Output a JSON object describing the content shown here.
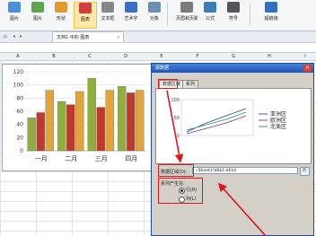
{
  "ribbon": {
    "items": [
      {
        "label": "图片",
        "icon": "picture-icon",
        "color": "#4a90d9"
      },
      {
        "label": "图片",
        "icon": "image-icon",
        "color": "#5fa44f"
      },
      {
        "label": "形状",
        "icon": "shapes-icon",
        "color": "#e09a2d"
      },
      {
        "label": "图表",
        "icon": "chart-icon",
        "color": "#d23d3d"
      },
      {
        "label": "文本框",
        "icon": "textbox-icon",
        "color": "#888888"
      },
      {
        "label": "艺术字",
        "icon": "wordart-icon",
        "color": "#3a6fc4"
      },
      {
        "label": "对象",
        "icon": "object-icon",
        "color": "#6b8fb5"
      },
      {
        "label": "页眉和页脚",
        "icon": "header-footer-icon",
        "color": "#7a7a7a"
      },
      {
        "label": "公式",
        "icon": "formula-icon",
        "color": "#3d7ab8"
      },
      {
        "label": "符号",
        "icon": "symbol-icon",
        "color": "#555555"
      },
      {
        "label": "超链接",
        "icon": "hyperlink-icon",
        "color": "#2f6fbf"
      }
    ]
  },
  "tabbar": {
    "doc_title": "文档1 中的 图表"
  },
  "sheet": {
    "columns": [
      "A",
      "B",
      "C",
      "D",
      "E",
      "F",
      "G",
      "H",
      "I"
    ]
  },
  "chart_data": {
    "type": "bar",
    "categories": [
      "一月",
      "二月",
      "三月",
      "四月"
    ],
    "yticks": [
      "0",
      "20",
      "40",
      "60",
      "80",
      "100",
      "120"
    ],
    "ylim": [
      0,
      120
    ],
    "series": [
      {
        "color": "#8fae3c",
        "values": [
          50,
          75,
          110,
          98
        ]
      },
      {
        "color": "#c0392b",
        "values": [
          58,
          70,
          66,
          88
        ]
      },
      {
        "color": "#e0a43b",
        "values": [
          92,
          90,
          92,
          92
        ]
      }
    ]
  },
  "dialog": {
    "title": "源数据",
    "tabs": [
      "数据区域",
      "系列"
    ],
    "preview": {
      "yticks": [
        "100",
        "50",
        "0"
      ],
      "legend": [
        {
          "label": "亚洲区",
          "color": "#1f4e9e"
        },
        {
          "label": "欧洲区",
          "color": "#7a2b8c"
        },
        {
          "label": "北美区",
          "color": "#2b8c6a"
        }
      ]
    },
    "range_label": "数据区域(D):",
    "range_value": "=Sheet1!$B$1:$E$4",
    "series_label": "系列产生在:",
    "options": [
      {
        "label": "行(R)",
        "selected": true
      },
      {
        "label": "列(L)",
        "selected": false
      }
    ]
  }
}
